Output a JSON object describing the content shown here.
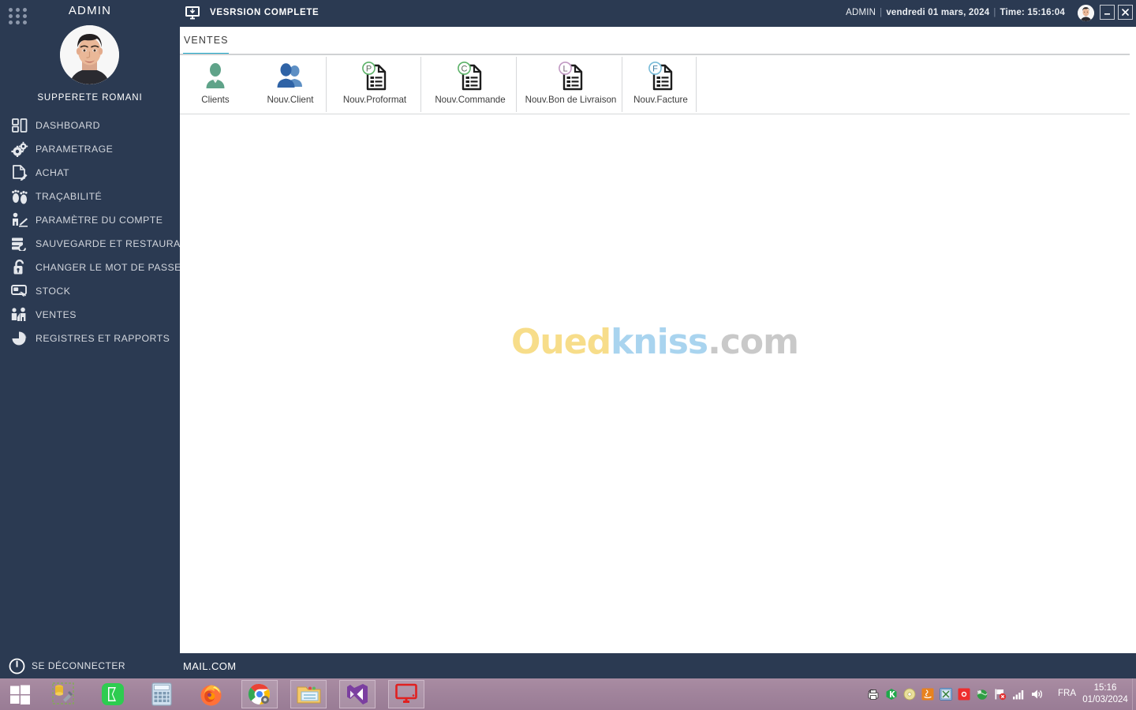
{
  "sidebar": {
    "grid_icon": "apps-grid-icon",
    "admin_title": "ADMIN",
    "profile_name": "SUPPERETE ROMANI",
    "items": [
      {
        "label": "DASHBOARD",
        "icon": "dashboard-icon"
      },
      {
        "label": "PARAMETRAGE",
        "icon": "gears-icon"
      },
      {
        "label": "ACHAT",
        "icon": "document-pen-icon"
      },
      {
        "label": "TRAÇABILITÉ",
        "icon": "footprints-icon"
      },
      {
        "label": "PARAMÈTRE DU COMPTE",
        "icon": "person-desk-icon"
      },
      {
        "label": "SAUVEGARDE ET RESTAURATION",
        "icon": "database-restore-icon"
      },
      {
        "label": "CHANGER LE MOT DE PASSE",
        "icon": "unlock-icon"
      },
      {
        "label": "STOCK",
        "icon": "stock-hand-icon"
      },
      {
        "label": "VENTES",
        "icon": "people-chart-icon"
      },
      {
        "label": "REGISTRES ET RAPPORTS",
        "icon": "pie-chart-icon"
      }
    ],
    "logout_label": "SE DÉCONNECTER",
    "logout_icon": "power-icon"
  },
  "topbar": {
    "app_icon": "monitor-icon",
    "app_title": "VESRSION COMPLETE",
    "user": "ADMIN",
    "date": "vendredi 01 mars, 2024",
    "time_label": "Time: 15:16:04",
    "separator": "|",
    "avatar_icon": "user-avatar",
    "minimize_icon": "minimize-icon",
    "close_icon": "close-icon"
  },
  "content": {
    "tabs": [
      {
        "label": "VENTES",
        "active": true
      }
    ],
    "ribbon_buttons": [
      {
        "label": "Clients",
        "icon": "single-person-icon",
        "badge": ""
      },
      {
        "label": "Nouv.Client",
        "icon": "two-people-icon",
        "badge": ""
      },
      {
        "label": "Nouv.Proformat",
        "icon": "document-icon",
        "badge": "P"
      },
      {
        "label": "Nouv.Commande",
        "icon": "document-icon",
        "badge": "C"
      },
      {
        "label": "Nouv.Bon de Livraison",
        "icon": "document-icon",
        "badge": "L"
      },
      {
        "label": "Nouv.Facture",
        "icon": "document-icon",
        "badge": "F"
      }
    ],
    "watermark": {
      "part1": "Oued",
      "part2": "kniss",
      "part3": ".com"
    }
  },
  "statusbar": {
    "text": "MAIL.COM"
  },
  "taskbar": {
    "items": [
      {
        "name": "start-button",
        "icon": "windows-logo-icon",
        "active": false
      },
      {
        "name": "sql-tools",
        "icon": "database-tools-icon",
        "active": false
      },
      {
        "name": "kaspersky",
        "icon": "green-b-icon",
        "active": false
      },
      {
        "name": "calculator",
        "icon": "calculator-icon",
        "active": false
      },
      {
        "name": "firefox",
        "icon": "firefox-icon",
        "active": false
      },
      {
        "name": "chrome",
        "icon": "chrome-icon",
        "active": true
      },
      {
        "name": "file-explorer",
        "icon": "folder-icon",
        "active": true
      },
      {
        "name": "visual-studio",
        "icon": "visual-studio-icon",
        "active": true
      },
      {
        "name": "app-window",
        "icon": "monitor-red-icon",
        "active": true
      }
    ],
    "tray_icons": [
      "printer-icon",
      "kaspersky-icon",
      "disc-icon",
      "java-icon",
      "excel-icon",
      "record-icon",
      "globe-icon",
      "flag-alert-icon",
      "network-icon",
      "volume-icon"
    ],
    "language": "FRA",
    "clock_time": "15:16",
    "clock_date": "01/03/2024"
  },
  "colors": {
    "navy": "#2b3a52",
    "accent": "#1ba7c8",
    "taskbar": "#a0839b",
    "watermark_yellow": "#f7dd8a",
    "watermark_blue": "#a9d4ef",
    "watermark_gray": "#c9c9c9"
  }
}
